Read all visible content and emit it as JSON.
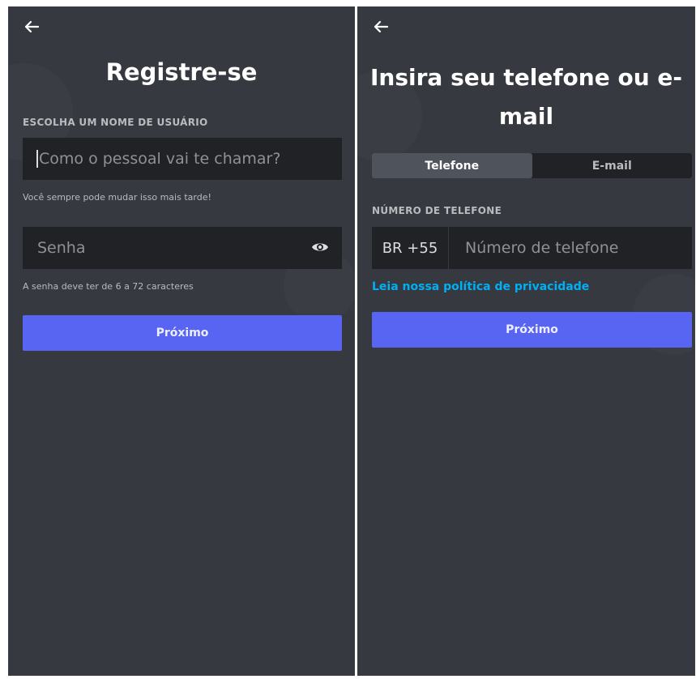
{
  "register_screen": {
    "back_icon": "arrow-left-icon",
    "title": "Registre-se",
    "username_label": "ESCOLHA UM NOME DE USUÁRIO",
    "username_placeholder": "Como o pessoal vai te chamar?",
    "username_hint": "Você sempre pode mudar isso mais tarde!",
    "password_placeholder": "Senha",
    "password_icon": "eye-icon",
    "password_hint": "A senha deve ter de 6 a 72 caracteres",
    "next_button": "Próximo"
  },
  "contact_screen": {
    "back_icon": "arrow-left-icon",
    "title": "Insira seu telefone ou e-mail",
    "tabs": [
      {
        "label": "Telefone",
        "active": true
      },
      {
        "label": "E-mail",
        "active": false
      }
    ],
    "phone_label": "NÚMERO DE TELEFONE",
    "country_code": "BR +55",
    "phone_placeholder": "Número de telefone",
    "privacy_link": "Leia nossa política de privacidade",
    "next_button": "Próximo"
  },
  "colors": {
    "background": "#36393f",
    "input": "#202225",
    "primary_button": "#5865f2",
    "link": "#00aff4"
  }
}
